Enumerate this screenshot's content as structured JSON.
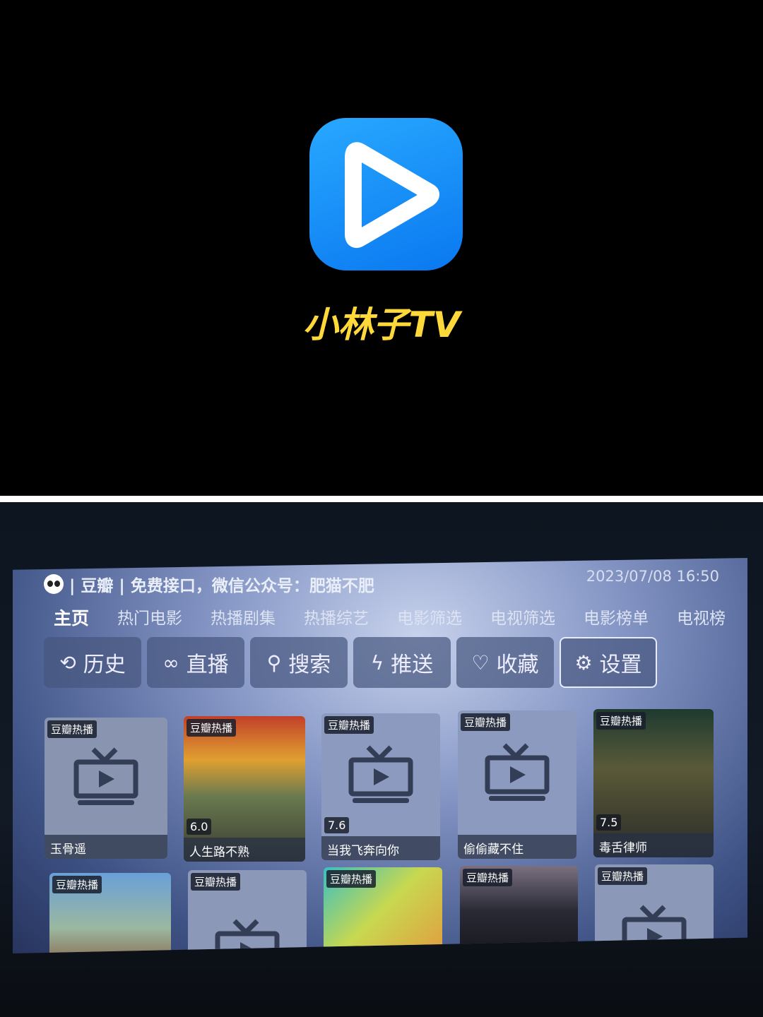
{
  "app": {
    "title": "小林子TV",
    "icon": "play-logo-icon",
    "brand_color": "#1a90ff",
    "title_color": "#ffd83a"
  },
  "tv": {
    "header": "| 豆瓣 | 免费接口，微信公众号：肥猫不肥",
    "datetime": "2023/07/08 16:50",
    "nav": [
      "主页",
      "热门电影",
      "热播剧集",
      "热播综艺",
      "电影筛选",
      "电视筛选",
      "电影榜单",
      "电视榜"
    ],
    "buttons": [
      {
        "label": "历史",
        "icon": "history-icon"
      },
      {
        "label": "直播",
        "icon": "live-icon"
      },
      {
        "label": "搜索",
        "icon": "search-icon"
      },
      {
        "label": "推送",
        "icon": "bolt-icon"
      },
      {
        "label": "收藏",
        "icon": "heart-icon"
      },
      {
        "label": "设置",
        "icon": "gear-icon"
      }
    ],
    "badge": "豆瓣热播",
    "row1": [
      {
        "title": "玉骨遥",
        "score": ""
      },
      {
        "title": "人生路不熟",
        "score": "6.0"
      },
      {
        "title": "当我飞奔向你",
        "score": "7.6"
      },
      {
        "title": "偷偷藏不住",
        "score": ""
      },
      {
        "title": "毒舌律师",
        "score": "7.5"
      }
    ]
  }
}
